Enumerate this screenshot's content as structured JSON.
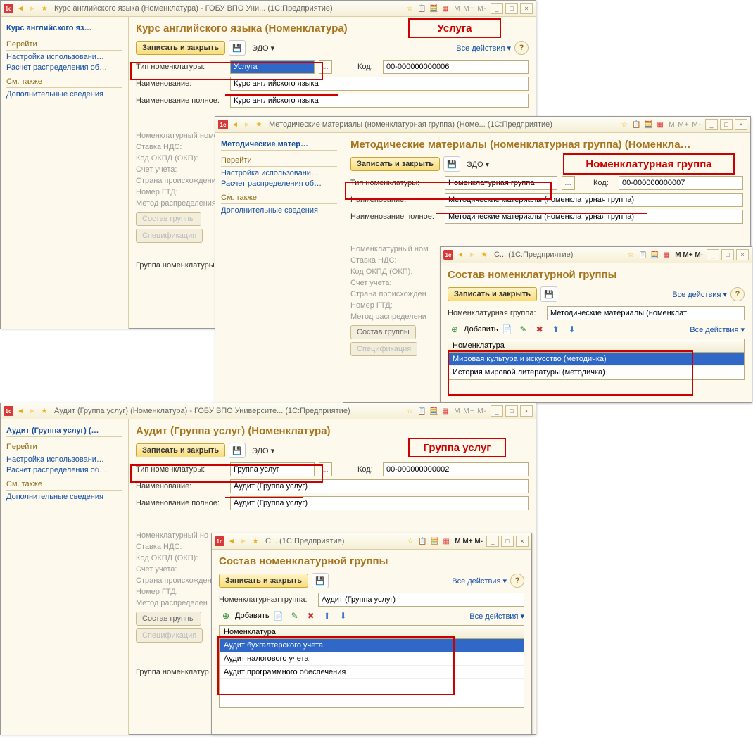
{
  "w1": {
    "title": "Курс английского языка (Номенклатура) - ГОБУ ВПО Уни...  (1С:Предприятие)",
    "sidebar_title": "Курс английского яз…",
    "sec_goto": "Перейти",
    "link1": "Настройка использовани…",
    "link2": "Расчет распределения об…",
    "sec_see": "См. также",
    "link3": "Дополнительные сведения",
    "page_title": "Курс английского языка (Номенклатура)",
    "btn_save": "Записать и закрыть",
    "btn_edo": "ЭДО ▾",
    "all_actions": "Все действия ▾",
    "lbl_type": "Тип номенклатуры:",
    "val_type": "Услуга",
    "lbl_code": "Код:",
    "val_code": "00-000000000006",
    "lbl_name": "Наименование:",
    "val_name": "Курс английского языка",
    "lbl_fullname": "Наименование полное:",
    "val_fullname": "Курс английского языка",
    "lbl_nomnum": "Номенклатурный номер",
    "lbl_nds": "Ставка НДС:",
    "lbl_okpd": "Код ОКПД (ОКП):",
    "lbl_acct": "Счет учета:",
    "lbl_country": "Страна происхождения:",
    "lbl_gtd": "Номер ГТД:",
    "lbl_method": "Метод распределения с",
    "btn_group": "Состав группы",
    "btn_spec": "Спецификация",
    "lbl_grp": "Группа номенклатуры:",
    "callout": "Услуга"
  },
  "w2": {
    "title": "Методические материалы (номенклатурная группа) (Номе...  (1С:Предприятие)",
    "sidebar_title": "Методические матер…",
    "page_title": "Методические материалы (номенклатурная группа) (Номенкла…",
    "val_type": "Номенклатурная группа",
    "val_code": "00-000000000007",
    "val_name": "Методические материалы (номенклатурная группа)",
    "val_fullname": "Методические материалы (номенклатурная группа)",
    "lbl_nomnum": "Номенклатурный ном",
    "lbl_country": "Страна происхожден",
    "lbl_method": "Метод распределени",
    "callout": "Номенклатурная группа"
  },
  "w3": {
    "title": "С...  (1С:Предприятие)",
    "page_title": "Состав номенклатурной группы",
    "btn_save": "Записать и закрыть",
    "all_actions": "Все действия ▾",
    "lbl_grp": "Номенклатурная группа:",
    "val_grp": "Методические материалы (номенклат",
    "btn_add": "Добавить",
    "head": "Номенклатура",
    "row1": "Мировая культура и искусство (методичка)",
    "row2": "История мировой литературы (методичка)"
  },
  "w4": {
    "title": "Аудит (Группа услуг) (Номенклатура) - ГОБУ ВПО Университе...  (1С:Предприятие)",
    "sidebar_title": "Аудит (Группа услуг) (…",
    "page_title": "Аудит (Группа услуг) (Номенклатура)",
    "val_type": "Группа услуг",
    "val_code": "00-000000000002",
    "val_name": "Аудит (Группа услуг)",
    "val_fullname": "Аудит (Группа услуг)",
    "lbl_nomnum": "Номенклатурный но",
    "lbl_country": "Страна происхожден",
    "lbl_method": "Метод распределен",
    "btn_group": "Состав группы",
    "btn_spec": "Спецификация",
    "lbl_grp": "Группа номенклатур",
    "callout": "Группа услуг"
  },
  "w5": {
    "title": "С...  (1С:Предприятие)",
    "page_title": "Состав номенклатурной группы",
    "val_grp": "Аудит (Группа услуг)",
    "row1": "Аудит бухгалтерского учета",
    "row2": "Аудит налогового учета",
    "row3": "Аудит программного обеспечения"
  },
  "mbtns": "M M+ M-"
}
